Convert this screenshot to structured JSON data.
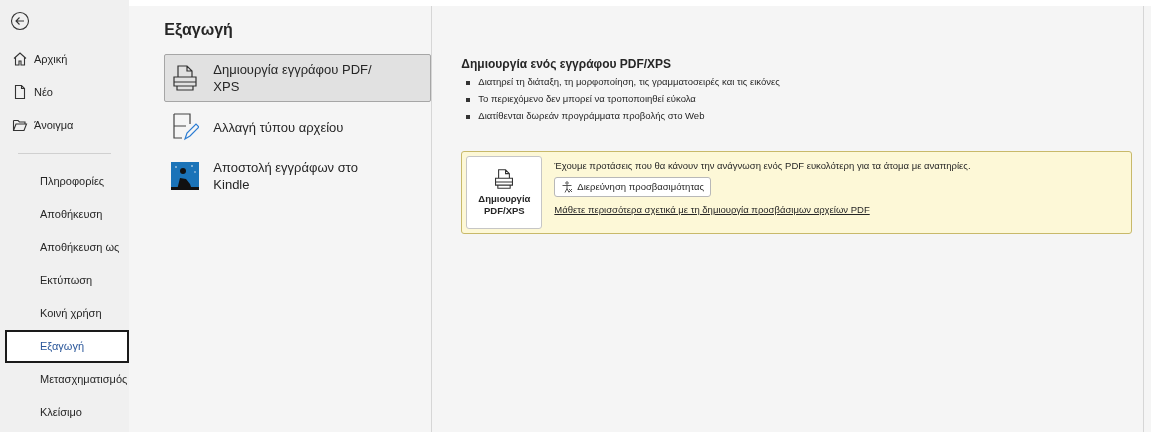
{
  "sidebar": {
    "top_items": [
      {
        "label": "Αρχική",
        "kind": "home"
      },
      {
        "label": "Νέο",
        "kind": "new"
      },
      {
        "label": "Άνοιγμα",
        "kind": "open"
      }
    ],
    "items": [
      {
        "label": "Πληροφορίες",
        "selected": false
      },
      {
        "label": "Αποθήκευση",
        "selected": false
      },
      {
        "label": "Αποθήκευση ως",
        "selected": false
      },
      {
        "label": "Εκτύπωση",
        "selected": false
      },
      {
        "label": "Κοινή χρήση",
        "selected": false
      },
      {
        "label": "Εξαγωγή",
        "selected": true
      },
      {
        "label": "Μετασχηματισμός",
        "selected": false
      },
      {
        "label": "Κλείσιμο",
        "selected": false
      }
    ]
  },
  "title": "Εξαγωγή",
  "options": [
    {
      "label": "Δημιουργία εγγράφου PDF/ XPS",
      "kind": "pdf",
      "selected": true
    },
    {
      "label": "Αλλαγή τύπου αρχείου",
      "kind": "filetype",
      "selected": false
    },
    {
      "label": "Αποστολή εγγράφων στο Kindle",
      "kind": "kindle",
      "selected": false
    }
  ],
  "detail": {
    "heading": "Δημιουργία ενός εγγράφου PDF/XPS",
    "bullets": [
      "Διατηρεί τη διάταξη, τη μορφοποίηση, τις γραμματοσειρές και τις εικόνες",
      "Το περιεχόμενο δεν μπορεί να τροποποιηθεί εύκολα",
      "Διατίθενται δωρεάν προγράμματα προβολής στο Web"
    ],
    "create_button": "Δημιουργία PDF/XPS",
    "notice": {
      "message": "Έχουμε προτάσεις που θα κάνουν την ανάγνωση ενός PDF ευκολότερη για τα άτομα με αναπηρίες.",
      "button": "Διερεύνηση προσβασιμότητας",
      "link": "Μάθετε περισσότερα σχετικά με τη δημιουργία προσβάσιμων αρχείων PDF"
    }
  }
}
